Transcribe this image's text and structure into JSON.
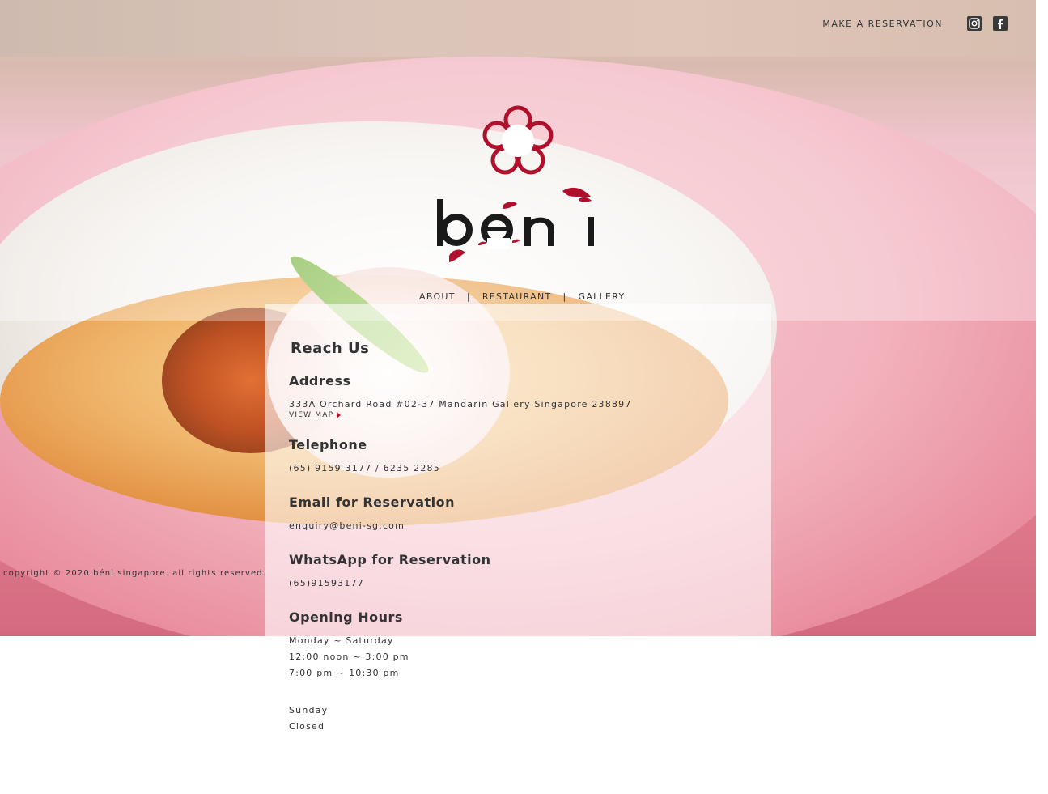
{
  "header": {
    "reservation_label": "MAKE A RESERVATION",
    "icons": [
      "instagram-icon",
      "facebook-icon"
    ]
  },
  "logo": {
    "text": "béni",
    "color_flower": "#b0102c",
    "color_text": "#1a1a1a"
  },
  "nav": {
    "items": [
      {
        "label": "ABOUT"
      },
      {
        "label": "RESTAURANT"
      },
      {
        "label": "GALLERY"
      }
    ],
    "separator": "|"
  },
  "contact": {
    "title": "Reach Us",
    "address_heading": "Address",
    "address_value": "333A Orchard Road #02-37 Mandarin Gallery Singapore 238897",
    "view_map_label": "VIEW MAP",
    "telephone_heading": "Telephone",
    "telephone_value": "(65) 9159 3177 / 6235 2285",
    "email_heading": "Email for Reservation",
    "email_value": "enquiry@beni-sg.com",
    "whatsapp_heading": "WhatsApp for Reservation",
    "whatsapp_value": "(65)91593177",
    "hours_heading": "Opening Hours",
    "hours_weekday_days": "Monday ~ Saturday",
    "hours_weekday_lunch": "12:00 noon ~ 3:00 pm",
    "hours_weekday_dinner": "7:00 pm ~ 10:30 pm",
    "hours_sunday_days": "Sunday",
    "hours_sunday_status": "Closed"
  },
  "footer": {
    "copyright": "copyright © 2020 béni singapore. all rights reserved."
  },
  "colors": {
    "accent": "#b0102c",
    "text": "#333333"
  }
}
